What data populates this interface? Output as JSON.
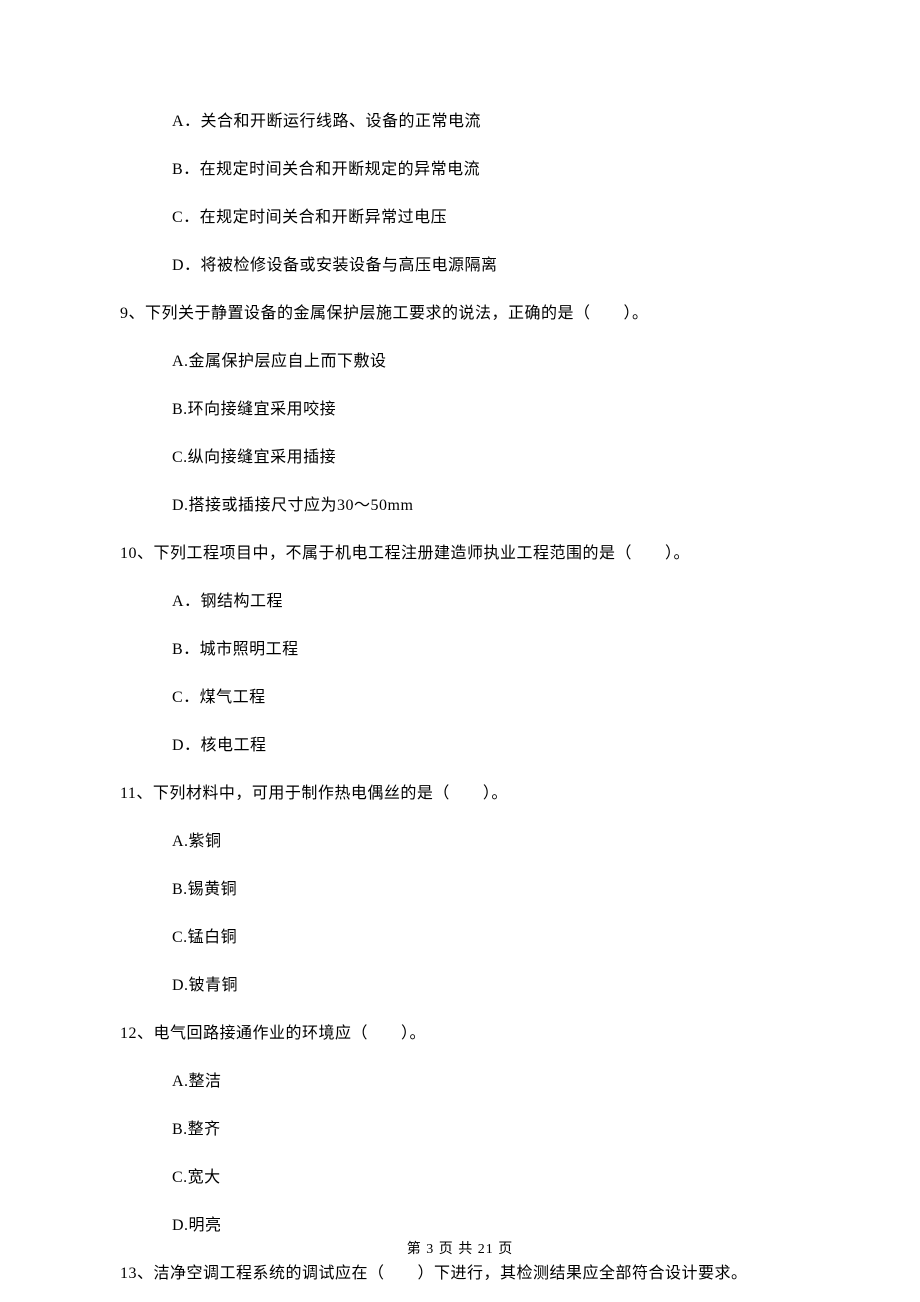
{
  "q_prev": {
    "options": [
      "A．关合和开断运行线路、设备的正常电流",
      "B．在规定时间关合和开断规定的异常电流",
      "C．在规定时间关合和开断异常过电压",
      "D．将被检修设备或安装设备与高压电源隔离"
    ]
  },
  "q9": {
    "stem": "9、下列关于静置设备的金属保护层施工要求的说法，正确的是（　　）。",
    "options": [
      "A.金属保护层应自上而下敷设",
      "B.环向接缝宜采用咬接",
      "C.纵向接缝宜采用插接",
      "D.搭接或插接尺寸应为30～50mm"
    ]
  },
  "q10": {
    "stem": "10、下列工程项目中，不属于机电工程注册建造师执业工程范围的是（　　）。",
    "options": [
      "A．钢结构工程",
      "B．城市照明工程",
      "C．煤气工程",
      "D．核电工程"
    ]
  },
  "q11": {
    "stem": "11、下列材料中，可用于制作热电偶丝的是（　　）。",
    "options": [
      "A.紫铜",
      "B.锡黄铜",
      "C.锰白铜",
      "D.铍青铜"
    ]
  },
  "q12": {
    "stem": "12、电气回路接通作业的环境应（　　）。",
    "options": [
      "A.整洁",
      "B.整齐",
      "C.宽大",
      "D.明亮"
    ]
  },
  "q13": {
    "stem": "13、洁净空调工程系统的调试应在（　　）下进行，其检测结果应全部符合设计要求。"
  },
  "pager": "第 3 页 共 21 页"
}
